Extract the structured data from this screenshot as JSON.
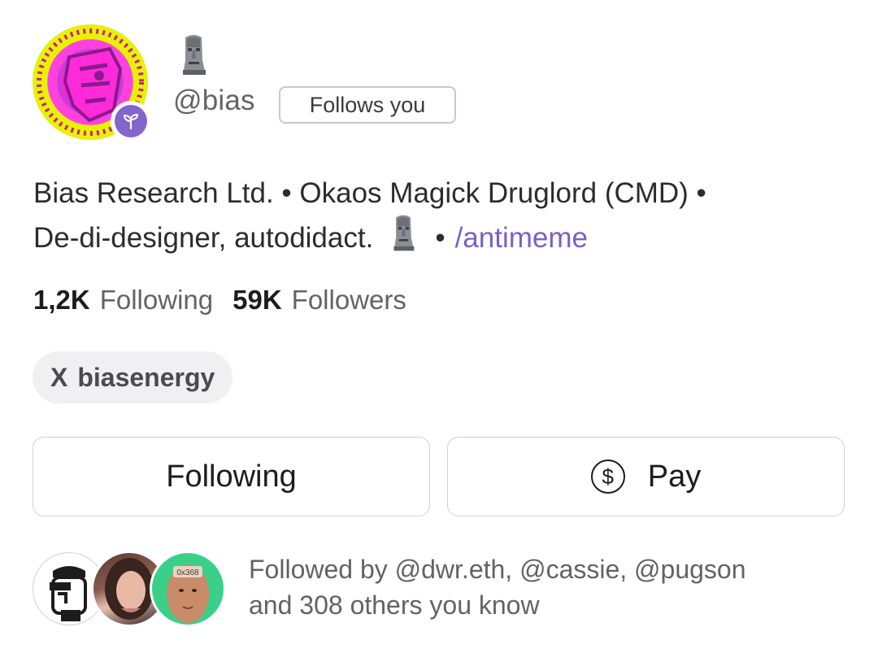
{
  "profile": {
    "display_name_emoji": "🗿",
    "handle": "@bias",
    "follows_you": "Follows you",
    "bio_line1": "Bias Research Ltd. • Okaos Magick Druglord (CMD) •",
    "bio_line2_text": "De-di-designer, autodidact.",
    "bio_line2_sep": "•",
    "bio_channel": "/antimeme"
  },
  "stats": {
    "following_count": "1,2K",
    "following_label": "Following",
    "followers_count": "59K",
    "followers_label": "Followers"
  },
  "social": {
    "icon": "x-logo-icon",
    "x_mark": "X",
    "username": "biasenergy"
  },
  "actions": {
    "following_label": "Following",
    "pay_label": "Pay",
    "pay_icon": "$"
  },
  "mutuals": {
    "line1": "Followed by @dwr.eth, @cassie, @pugson",
    "line2": "and 308 others you know",
    "avatar3_text": "0x368"
  },
  "colors": {
    "link": "#7a5fc8",
    "badge": "#8465cb"
  }
}
